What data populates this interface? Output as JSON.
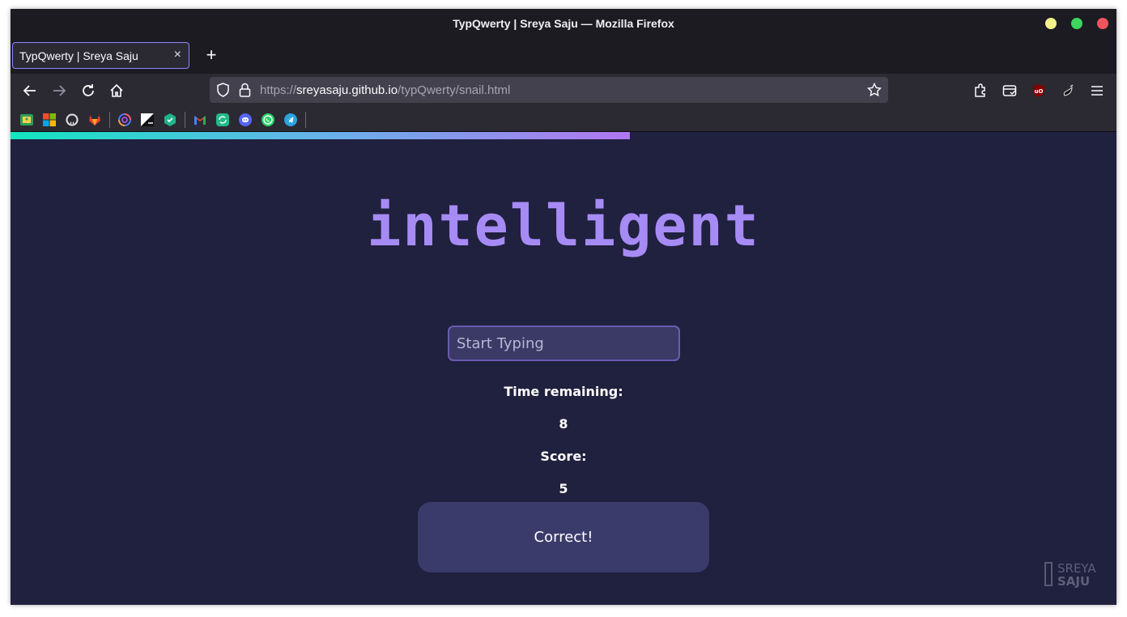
{
  "window": {
    "title": "TypQwerty | Sreya Saju — Mozilla Firefox"
  },
  "tab": {
    "label": "TypQwerty | Sreya Saju",
    "close_glyph": "×",
    "new_tab_glyph": "+"
  },
  "urlbar": {
    "scheme": "https://",
    "domain": "sreyasaju.github.io",
    "path": "/typQwerty/snail.html"
  },
  "bookmarks": [
    {
      "name": "google-classroom",
      "color": "#2e9e5a"
    },
    {
      "name": "microsoft",
      "color": "#f25022"
    },
    {
      "name": "github",
      "color": "#e6e6e6"
    },
    {
      "name": "gitlab",
      "color": "#e24329"
    },
    {
      "name": "swirl",
      "color": "#4a7bf0"
    },
    {
      "name": "notion",
      "color": "#ffffff"
    },
    {
      "name": "codeforces",
      "color": "#1fb38b"
    },
    {
      "name": "gmail",
      "color": "#ea4335"
    },
    {
      "name": "sync",
      "color": "#25b887"
    },
    {
      "name": "discord",
      "color": "#5865f2"
    },
    {
      "name": "whatsapp",
      "color": "#25d366"
    },
    {
      "name": "telegram",
      "color": "#2aa3e0"
    }
  ],
  "game": {
    "progress_percent": 56,
    "word": "intelligent",
    "input_placeholder": "Start Typing",
    "input_value": "",
    "time_label": "Time remaining:",
    "time_value": "8",
    "score_label": "Score:",
    "score_value": "5",
    "message": "Correct!"
  },
  "logo": {
    "line1": "SREYA",
    "line2": "SAJU"
  },
  "colors": {
    "background": "#20203f",
    "word": "#a68bf5",
    "message_box": "#3a3b6b"
  }
}
